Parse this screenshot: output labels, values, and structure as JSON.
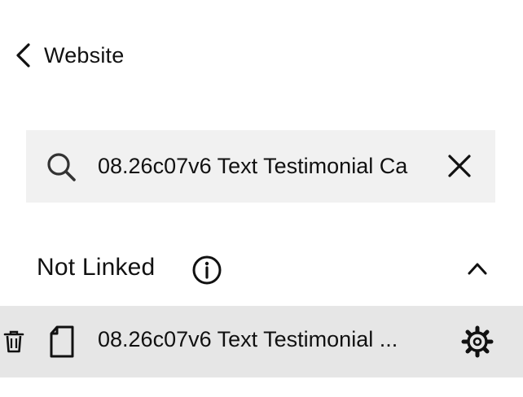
{
  "header": {
    "back_label": "Website",
    "back_icon": "chevron-left-icon"
  },
  "search": {
    "value": "08.26c07v6 Text Testimonial Ca",
    "placeholder": "",
    "search_icon": "search-icon",
    "clear_icon": "close-icon"
  },
  "section": {
    "title": "Not Linked",
    "info_icon": "info-icon",
    "collapse_icon": "chevron-up-icon",
    "items": [
      {
        "label": "08.26c07v6 Text Testimonial ...",
        "left_icon": "trash-icon",
        "type_icon": "page-icon",
        "settings_icon": "gear-icon"
      }
    ]
  },
  "colors": {
    "search_bg": "#f1f1f1",
    "row_selected_bg": "#e6e6e6",
    "text": "#111111"
  }
}
